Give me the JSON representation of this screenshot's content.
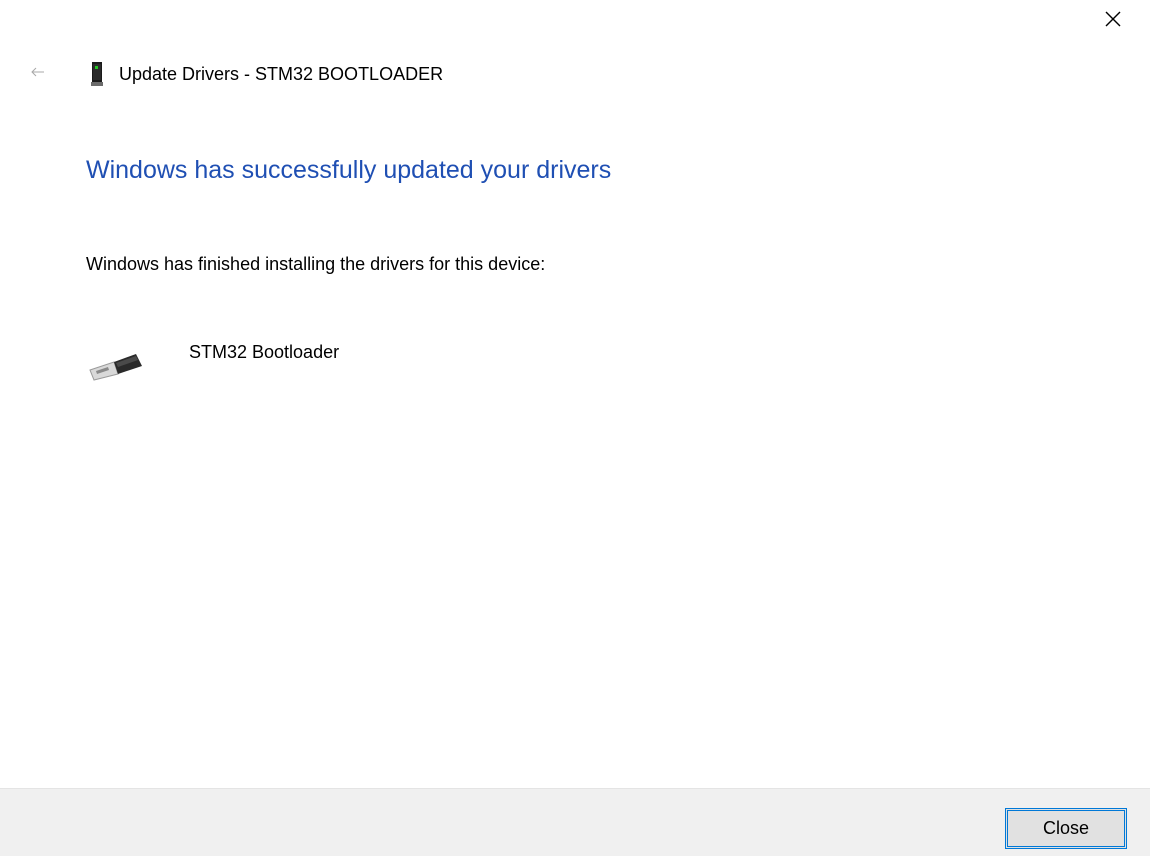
{
  "window": {
    "title": "Update Drivers - STM32  BOOTLOADER",
    "title_icon": "device-icon",
    "close_icon": "close-icon",
    "back_icon": "back-arrow-icon"
  },
  "main": {
    "heading": "Windows has successfully updated your drivers",
    "description": "Windows has finished installing the drivers for this device:",
    "device": {
      "name": "STM32 Bootloader",
      "icon": "usb-plug-icon"
    }
  },
  "footer": {
    "close_label": "Close"
  },
  "colors": {
    "heading": "#1f4fb3",
    "footer_background": "#f0f0f0",
    "button_border": "#0078d7"
  }
}
